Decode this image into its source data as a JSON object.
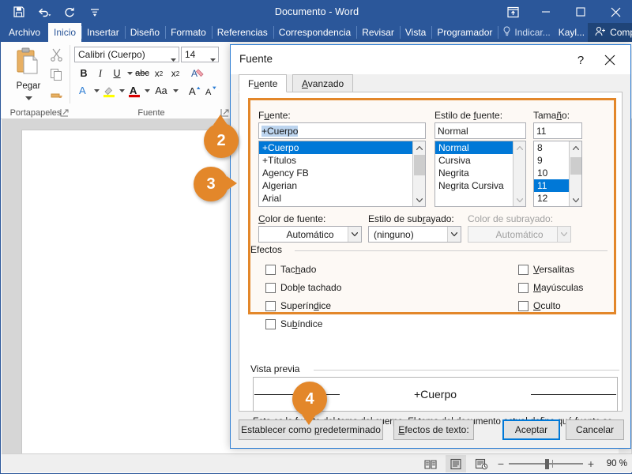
{
  "window": {
    "title": "Documento - Word",
    "quick_access": [
      {
        "name": "save-icon",
        "label": "Guardar"
      },
      {
        "name": "undo-icon",
        "label": "Deshacer"
      },
      {
        "name": "redo-icon",
        "label": "Rehacer"
      },
      {
        "name": "customize-qat-icon",
        "label": "Personalizar barra de herramientas de acceso rápido"
      }
    ],
    "controls": [
      {
        "name": "ribbon-display-options-icon",
        "label": "Opciones de presentación de la cinta de opciones"
      },
      {
        "name": "minimize-icon",
        "label": "Minimizar"
      },
      {
        "name": "maximize-icon",
        "label": "Maximizar"
      },
      {
        "name": "close-icon",
        "label": "Cerrar"
      }
    ]
  },
  "ribbon": {
    "tabs": [
      {
        "label": "Archivo",
        "active": false
      },
      {
        "label": "Inicio",
        "active": true
      },
      {
        "label": "Insertar",
        "active": false
      },
      {
        "label": "Diseño",
        "active": false
      },
      {
        "label": "Formato",
        "active": false
      },
      {
        "label": "Referencias",
        "active": false
      },
      {
        "label": "Correspondencia",
        "active": false
      },
      {
        "label": "Revisar",
        "active": false
      },
      {
        "label": "Vista",
        "active": false
      },
      {
        "label": "Programador",
        "active": false
      }
    ],
    "tell_me": "Indicar...",
    "account": "Kayl...",
    "share": "Compartir",
    "groups": {
      "clipboard": {
        "label": "Portapapeles",
        "paste_label": "Pegar"
      },
      "font": {
        "label": "Fuente",
        "font_name": "Calibri (Cuerpo)",
        "font_size": "14",
        "buttons": [
          "B",
          "I",
          "U",
          "abc",
          "x₂",
          "x²",
          "Aa"
        ]
      }
    }
  },
  "dialog": {
    "title": "Fuente",
    "help_glyph": "?",
    "tabs": [
      {
        "label": "Fuente",
        "active": true,
        "accel": "u"
      },
      {
        "label": "Avanzado",
        "active": false,
        "accel": "A"
      }
    ],
    "font_field": {
      "label": "Fuente:",
      "value": "+Cuerpo",
      "options": [
        "+Cuerpo",
        "+Títulos",
        "Agency FB",
        "Algerian",
        "Arial"
      ],
      "selected_index": 0
    },
    "style_field": {
      "label": "Estilo de fuente:",
      "value": "Normal",
      "options": [
        "Normal",
        "Cursiva",
        "Negrita",
        "Negrita Cursiva"
      ],
      "selected_index": 0
    },
    "size_field": {
      "label": "Tamaño:",
      "value": "11",
      "options": [
        "8",
        "9",
        "10",
        "11",
        "12"
      ],
      "selected_index": 3
    },
    "font_color": {
      "label": "Color de fuente:",
      "value": "Automático",
      "disabled": false
    },
    "underline_style": {
      "label": "Estilo de subrayado:",
      "value": "(ninguno)",
      "disabled": false
    },
    "underline_color": {
      "label": "Color de subrayado:",
      "value": "Automático",
      "disabled": true
    },
    "effects": {
      "label": "Efectos",
      "left": [
        {
          "label": "Tachado",
          "checked": false
        },
        {
          "label": "Doble tachado",
          "checked": false
        },
        {
          "label": "Superíndice",
          "checked": false
        },
        {
          "label": "Subíndice",
          "checked": false
        }
      ],
      "right": [
        {
          "label": "Versalitas",
          "checked": false
        },
        {
          "label": "Mayúsculas",
          "checked": false
        },
        {
          "label": "Oculto",
          "checked": false
        }
      ]
    },
    "preview": {
      "label": "Vista previa",
      "sample_text": "+Cuerpo",
      "note": "Esta es la fuente del tema del cuerpo. El tema del documento actual define qué fuente se utilizará."
    },
    "footer": {
      "set_default": "Establecer como predeterminado",
      "text_effects": "Efectos de texto:",
      "ok": "Aceptar",
      "cancel": "Cancelar"
    }
  },
  "callouts": [
    {
      "number": "2",
      "direction": "up"
    },
    {
      "number": "3",
      "direction": "right"
    },
    {
      "number": "4",
      "direction": "down"
    }
  ],
  "statusbar": {
    "views": [
      {
        "name": "read-mode-icon",
        "selected": false
      },
      {
        "name": "print-layout-icon",
        "selected": true
      },
      {
        "name": "web-layout-icon",
        "selected": false
      }
    ],
    "zoom_out": "−",
    "zoom_in": "+",
    "zoom_level": "90 %"
  },
  "colors": {
    "brand_blue": "#2b579a",
    "accent_orange": "#e3872a",
    "selection_blue": "#0078d7"
  }
}
